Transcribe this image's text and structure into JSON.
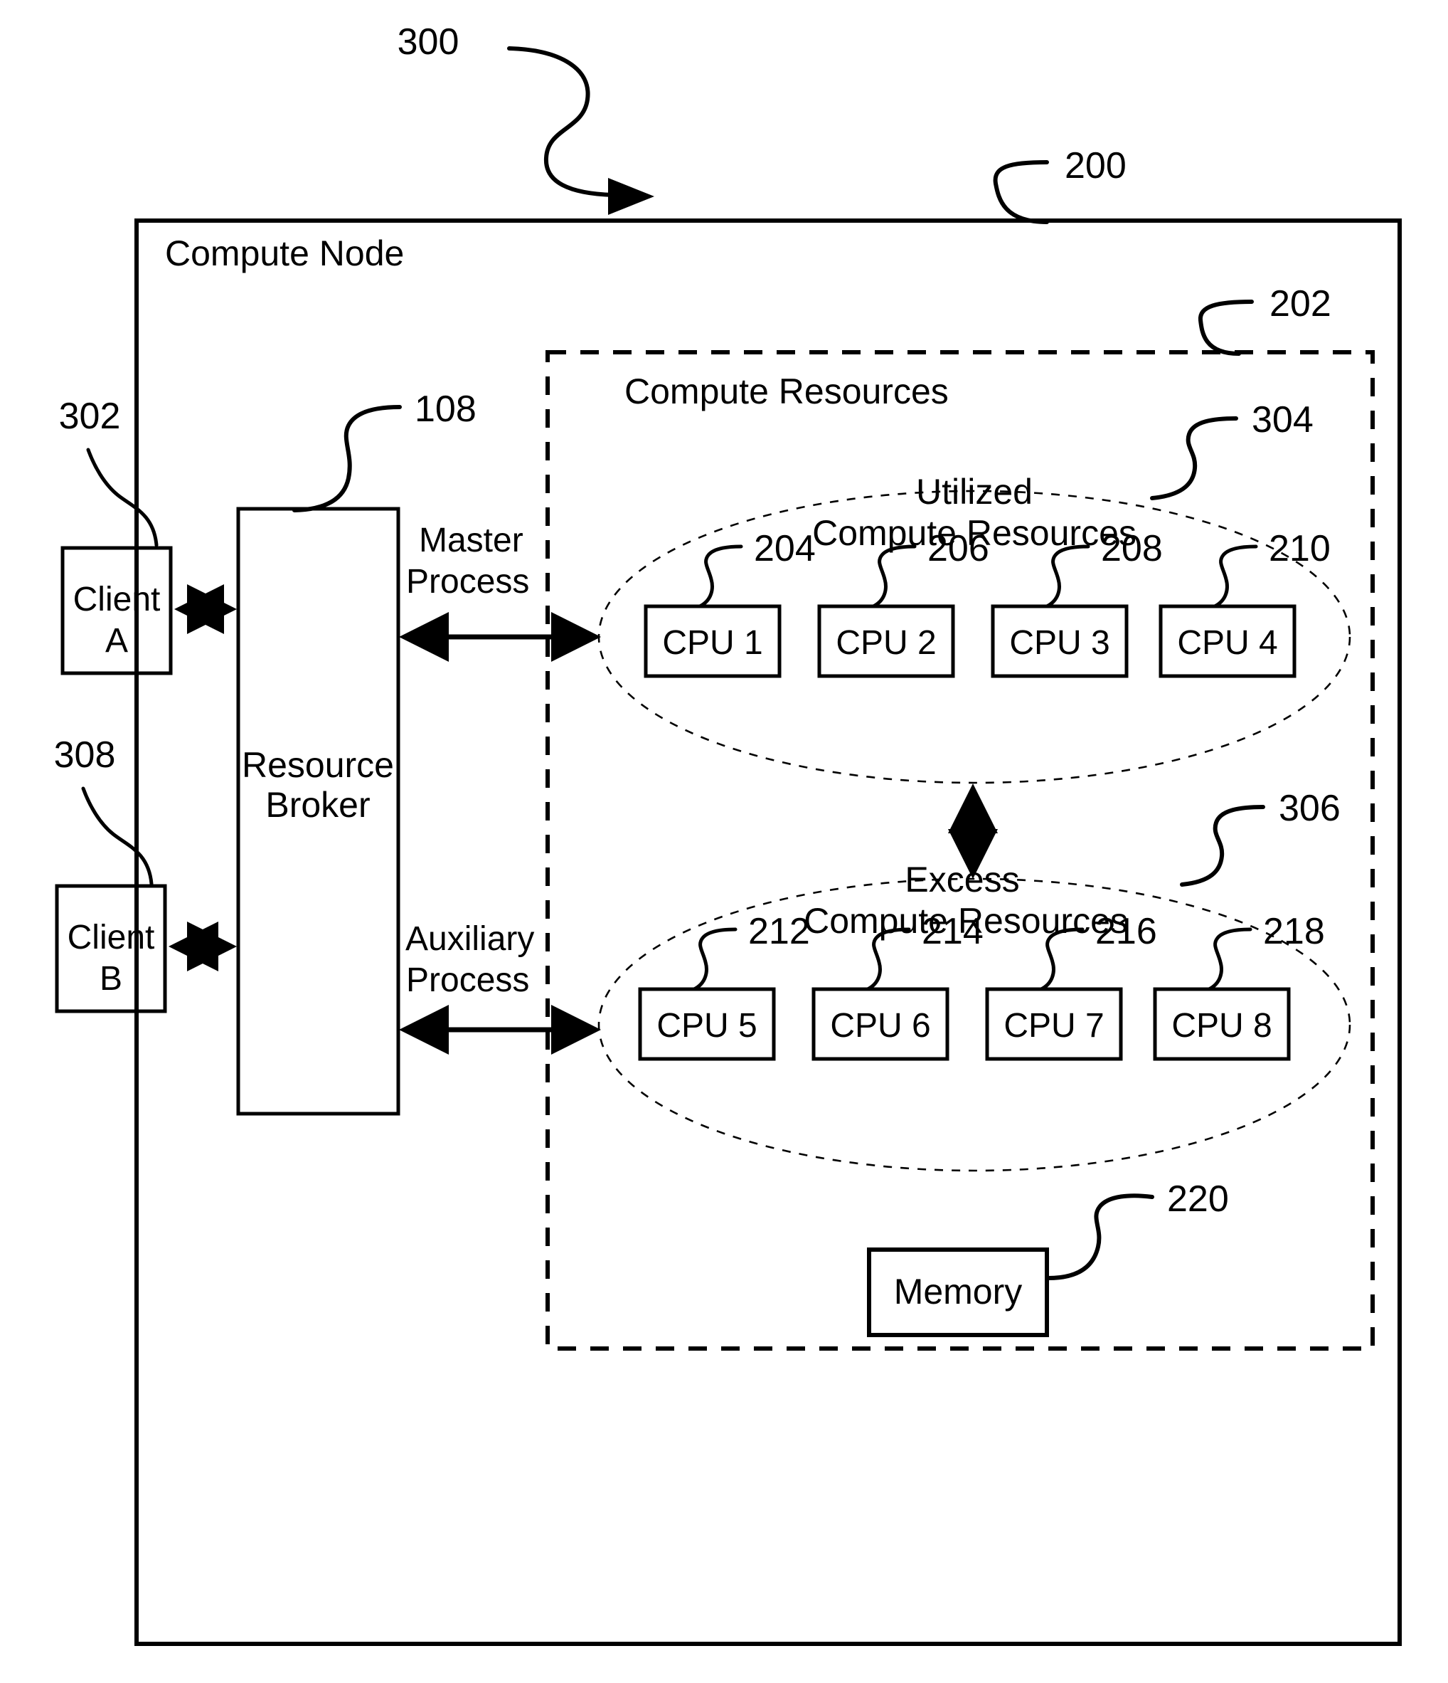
{
  "figure": {
    "figure_ref": "300",
    "node_ref": "200",
    "resources_ref": "202"
  },
  "compute_node": {
    "title": "Compute Node",
    "ref": "200"
  },
  "compute_resources": {
    "title": "Compute Resources",
    "ref": "202"
  },
  "resource_broker": {
    "line1": "Resource",
    "line2": "Broker",
    "ref": "108"
  },
  "clients": [
    {
      "line1": "Client",
      "line2": "A",
      "ref": "302"
    },
    {
      "line1": "Client",
      "line2": "B",
      "ref": "308"
    }
  ],
  "processes": [
    {
      "line1": "Master",
      "line2": "Process"
    },
    {
      "line1": "Auxiliary",
      "line2": "Process"
    }
  ],
  "utilized_group": {
    "title_line1": "Utilized",
    "title_line2": "Compute Resources",
    "ref": "304",
    "cpus": [
      {
        "label": "CPU 1",
        "ref": "204"
      },
      {
        "label": "CPU 2",
        "ref": "206"
      },
      {
        "label": "CPU 3",
        "ref": "208"
      },
      {
        "label": "CPU 4",
        "ref": "210"
      }
    ]
  },
  "excess_group": {
    "title_line1": "Excess",
    "title_line2": "Compute Resources",
    "ref": "306",
    "cpus": [
      {
        "label": "CPU 5",
        "ref": "212"
      },
      {
        "label": "CPU 6",
        "ref": "214"
      },
      {
        "label": "CPU 7",
        "ref": "216"
      },
      {
        "label": "CPU 8",
        "ref": "218"
      }
    ]
  },
  "memory": {
    "label": "Memory",
    "ref": "220"
  },
  "colors": {
    "stroke": "#000000",
    "background": "#ffffff"
  }
}
